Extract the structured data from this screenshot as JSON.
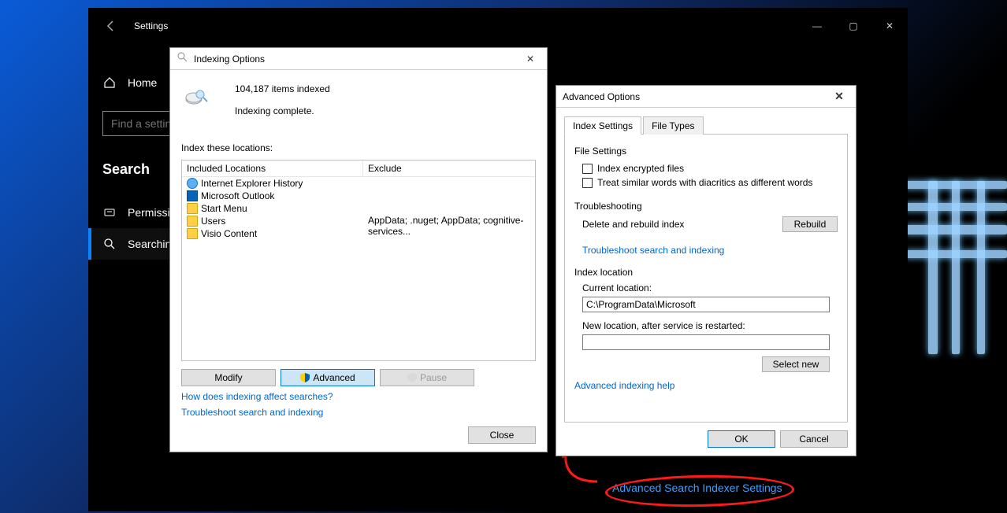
{
  "settings": {
    "title": "Settings",
    "home": "Home",
    "search_placeholder": "Find a setting",
    "category": "Search",
    "items": [
      {
        "label": "Permissions & History"
      },
      {
        "label": "Searching Windows"
      }
    ],
    "advanced_link": "Advanced Search Indexer Settings",
    "win_min": "—",
    "win_max": "▢",
    "win_close": "✕"
  },
  "indexing": {
    "title": "Indexing Options",
    "items_indexed": "104,187 items indexed",
    "status": "Indexing complete.",
    "locations_label": "Index these locations:",
    "col_included": "Included Locations",
    "col_exclude": "Exclude",
    "rows": [
      {
        "name": "Internet Explorer History",
        "exclude": "",
        "icon": "ie"
      },
      {
        "name": "Microsoft Outlook",
        "exclude": "",
        "icon": "outlook"
      },
      {
        "name": "Start Menu",
        "exclude": "",
        "icon": "folder"
      },
      {
        "name": "Users",
        "exclude": "AppData; .nuget; AppData; cognitive-services...",
        "icon": "folder"
      },
      {
        "name": "Visio Content",
        "exclude": "",
        "icon": "folder"
      }
    ],
    "modify": "Modify",
    "advanced": "Advanced",
    "pause": "Pause",
    "link_affect": "How does indexing affect searches?",
    "link_troubleshoot": "Troubleshoot search and indexing",
    "close": "Close"
  },
  "advanced": {
    "title": "Advanced Options",
    "tab_index": "Index Settings",
    "tab_types": "File Types",
    "file_settings": "File Settings",
    "chk_encrypted": "Index encrypted files",
    "chk_diacritics": "Treat similar words with diacritics as different words",
    "troubleshooting": "Troubleshooting",
    "delete_rebuild": "Delete and rebuild index",
    "rebuild": "Rebuild",
    "troubleshoot_link": "Troubleshoot search and indexing",
    "index_location": "Index location",
    "current_location_label": "Current location:",
    "current_location_path": "C:\\ProgramData\\Microsoft",
    "new_location_label": "New location, after service is restarted:",
    "select_new": "Select new",
    "help_link": "Advanced indexing help",
    "ok": "OK",
    "cancel": "Cancel"
  }
}
